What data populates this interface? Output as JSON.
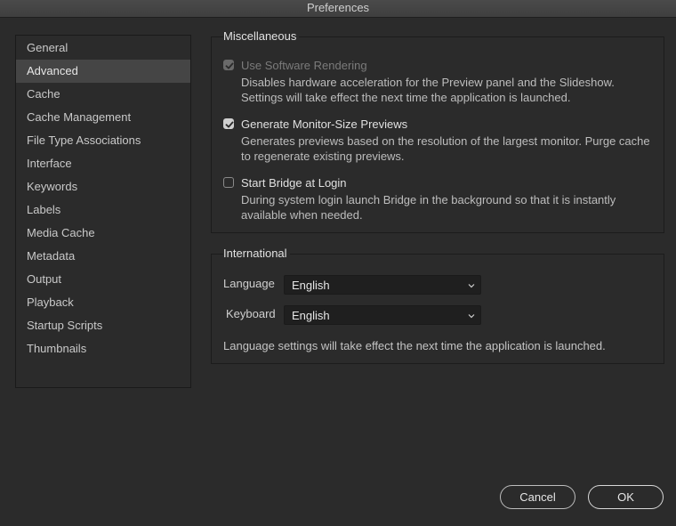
{
  "window": {
    "title": "Preferences"
  },
  "sidebar": {
    "items": [
      {
        "label": "General",
        "selected": false
      },
      {
        "label": "Advanced",
        "selected": true
      },
      {
        "label": "Cache",
        "selected": false
      },
      {
        "label": "Cache Management",
        "selected": false
      },
      {
        "label": "File Type Associations",
        "selected": false
      },
      {
        "label": "Interface",
        "selected": false
      },
      {
        "label": "Keywords",
        "selected": false
      },
      {
        "label": "Labels",
        "selected": false
      },
      {
        "label": "Media Cache",
        "selected": false
      },
      {
        "label": "Metadata",
        "selected": false
      },
      {
        "label": "Output",
        "selected": false
      },
      {
        "label": "Playback",
        "selected": false
      },
      {
        "label": "Startup Scripts",
        "selected": false
      },
      {
        "label": "Thumbnails",
        "selected": false
      }
    ]
  },
  "misc": {
    "title": "Miscellaneous",
    "options": [
      {
        "label": "Use Software Rendering",
        "checked": true,
        "disabled": true,
        "description": "Disables hardware acceleration for the Preview panel and the Slideshow. Settings will take effect the next time the application is launched."
      },
      {
        "label": "Generate Monitor-Size Previews",
        "checked": true,
        "disabled": false,
        "description": "Generates previews based on the resolution of the largest monitor.  Purge cache to regenerate existing previews."
      },
      {
        "label": "Start Bridge at Login",
        "checked": false,
        "disabled": false,
        "description": "During system login launch Bridge in the background so that it is instantly available when needed."
      }
    ]
  },
  "international": {
    "title": "International",
    "language_label": "Language",
    "language_value": "English",
    "keyboard_label": "Keyboard",
    "keyboard_value": "English",
    "note": "Language settings will take effect the next time the application is launched."
  },
  "buttons": {
    "cancel": "Cancel",
    "ok": "OK"
  },
  "colors": {
    "background": "#2b2b2b",
    "selected_item": "#454545",
    "text": "#d8d8d8"
  }
}
